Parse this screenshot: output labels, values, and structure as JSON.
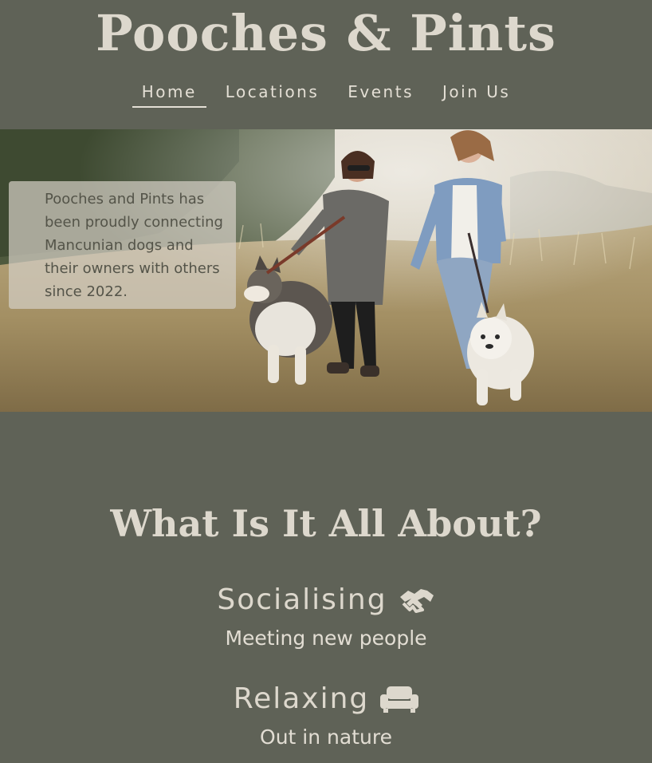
{
  "header": {
    "title": "Pooches & Pints"
  },
  "nav": {
    "items": [
      {
        "label": "Home",
        "active": true
      },
      {
        "label": "Locations",
        "active": false
      },
      {
        "label": "Events",
        "active": false
      },
      {
        "label": "Join Us",
        "active": false
      }
    ]
  },
  "hero": {
    "text": "Pooches and Pints has been proudly connecting Mancunian dogs and their owners with others since 2022.",
    "image": "two-women-running-with-dogs-in-field"
  },
  "about": {
    "title": "What Is It All About?",
    "features": [
      {
        "title": "Socialising",
        "icon": "handshake-icon",
        "subtitle": "Meeting new people"
      },
      {
        "title": "Relaxing",
        "icon": "couch-icon",
        "subtitle": "Out in nature"
      }
    ]
  },
  "colors": {
    "background": "#5f6257",
    "text": "#ddd8cd"
  }
}
